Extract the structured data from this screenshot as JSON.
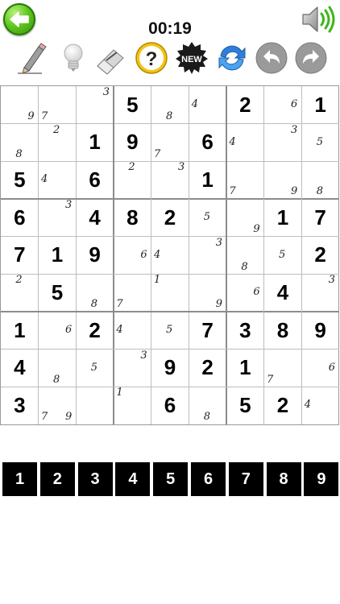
{
  "header": {
    "timer": "00:19"
  },
  "toolbar": {
    "tools": [
      {
        "name": "pencil-icon",
        "label": "Pencil"
      },
      {
        "name": "lightbulb-icon",
        "label": "Hint"
      },
      {
        "name": "eraser-icon",
        "label": "Eraser"
      },
      {
        "name": "help-icon",
        "label": "?"
      },
      {
        "name": "new-game-icon",
        "label": "NEW"
      },
      {
        "name": "refresh-icon",
        "label": "Refresh"
      },
      {
        "name": "undo-icon",
        "label": "Undo"
      },
      {
        "name": "redo-icon",
        "label": "Redo"
      }
    ]
  },
  "colors": {
    "back_green": "#5fc51e",
    "help_yellow": "#f2c316",
    "refresh_blue": "#2f7fd8",
    "undo_gray": "#9a9a9a"
  },
  "board": {
    "values": [
      [
        0,
        0,
        0,
        5,
        0,
        0,
        2,
        0,
        1
      ],
      [
        0,
        0,
        1,
        9,
        0,
        6,
        0,
        0,
        0
      ],
      [
        5,
        0,
        6,
        0,
        0,
        1,
        0,
        0,
        0
      ],
      [
        6,
        0,
        4,
        8,
        2,
        0,
        0,
        1,
        7
      ],
      [
        7,
        1,
        9,
        0,
        0,
        0,
        0,
        0,
        2
      ],
      [
        0,
        5,
        0,
        0,
        0,
        0,
        0,
        4,
        0
      ],
      [
        1,
        0,
        2,
        0,
        0,
        7,
        3,
        8,
        9
      ],
      [
        4,
        0,
        0,
        0,
        9,
        2,
        1,
        0,
        0
      ],
      [
        3,
        0,
        0,
        0,
        6,
        0,
        5,
        2,
        0
      ]
    ],
    "candidates": [
      [
        [
          9
        ],
        [
          7
        ],
        [
          3
        ],
        [],
        [
          8
        ],
        [
          4
        ],
        [],
        [
          6
        ],
        []
      ],
      [
        [
          8
        ],
        [
          2
        ],
        [],
        [],
        [
          7
        ],
        [],
        [
          4
        ],
        [
          3
        ],
        [
          5
        ]
      ],
      [
        [],
        [
          4
        ],
        [],
        [
          2
        ],
        [
          3
        ],
        [],
        [
          7
        ],
        [
          9
        ],
        [
          8
        ]
      ],
      [
        [],
        [
          3
        ],
        [],
        [],
        [],
        [
          5
        ],
        [
          9
        ],
        [],
        []
      ],
      [
        [],
        [],
        [],
        [
          6
        ],
        [
          4
        ],
        [
          3
        ],
        [
          8
        ],
        [
          5
        ],
        []
      ],
      [
        [
          2
        ],
        [],
        [
          8
        ],
        [
          7
        ],
        [
          1
        ],
        [
          9
        ],
        [
          6
        ],
        [],
        [
          3
        ]
      ],
      [
        [],
        [
          6
        ],
        [],
        [
          4
        ],
        [
          5
        ],
        [],
        [],
        [],
        []
      ],
      [
        [],
        [
          8
        ],
        [
          5
        ],
        [
          3
        ],
        [],
        [],
        [],
        [
          7
        ],
        [
          6
        ]
      ],
      [
        [],
        [
          9,
          7
        ],
        [],
        [
          1
        ],
        [],
        [
          8
        ],
        [],
        [],
        [
          4
        ]
      ]
    ]
  },
  "numpad": {
    "keys": [
      "1",
      "2",
      "3",
      "4",
      "5",
      "6",
      "7",
      "8",
      "9"
    ]
  }
}
